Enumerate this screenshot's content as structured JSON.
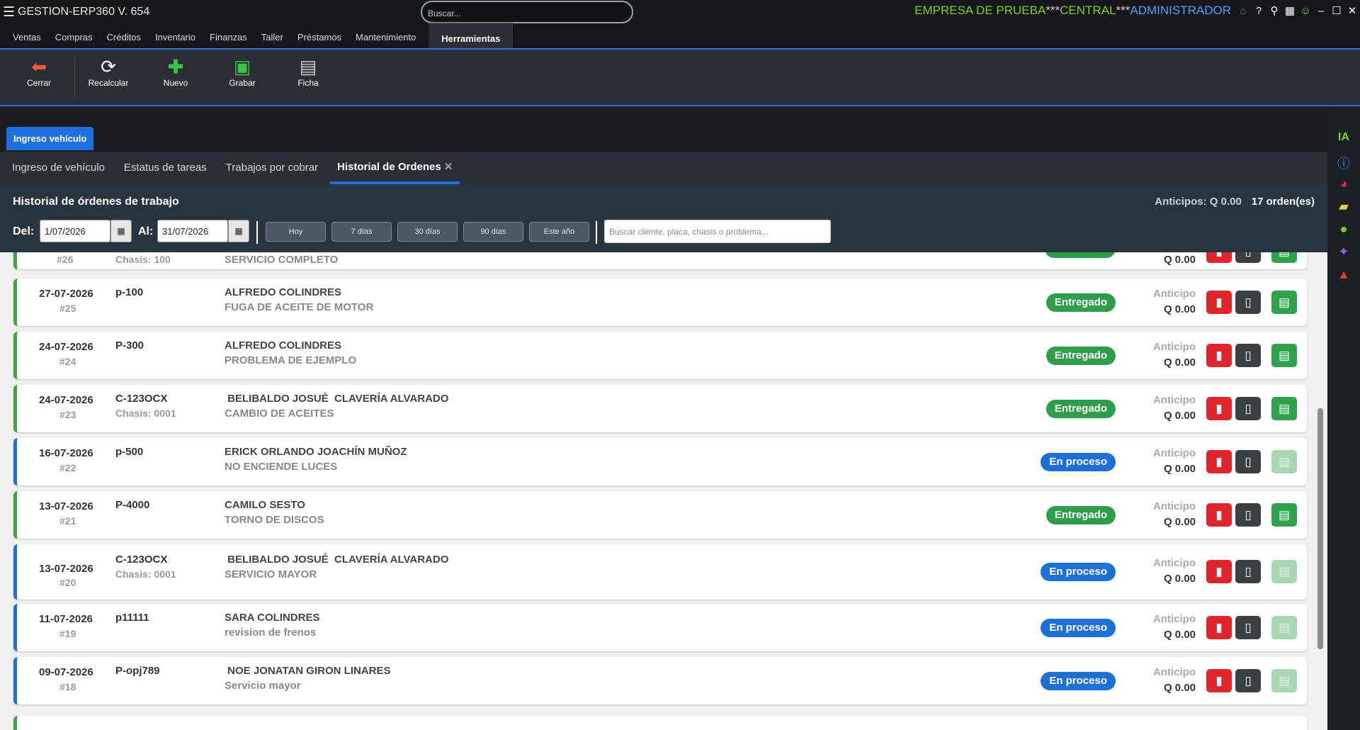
{
  "titlebar": {
    "app_title": "GESTION-ERP360 V. 654",
    "search_placeholder": "Buscar...",
    "company": "EMPRESA DE PRUEBA",
    "branch": "CENTRAL",
    "user": "ADMINISTRADOR",
    "sep": "***"
  },
  "menu": [
    "Ventas",
    "Compras",
    "Créditos",
    "Inventario",
    "Finanzas",
    "Taller",
    "Préstamos",
    "Mantenimiento",
    "Herramientas"
  ],
  "ribbon": {
    "close": "Cerrar",
    "recalc": "Recalcular",
    "new": "Nuevo",
    "save": "Grabar",
    "sheet": "Ficha"
  },
  "doc_tab": "Ingreso vehículo",
  "subtabs": [
    "Ingreso de vehículo",
    "Estatus de tareas",
    "Trabajos por cobrar",
    "Historial de Ordenes"
  ],
  "filter": {
    "title": "Historial de órdenes de trabajo",
    "anticipos_label": "Anticipos: Q 0.00",
    "count_label": "17 orden(es)",
    "del_label": "Del:",
    "al_label": "Al:",
    "from": "1/07/2026",
    "to": "31/07/2026",
    "quick": [
      "Hoy",
      "7 días",
      "30 días",
      "90 días",
      "Este año"
    ],
    "search_placeholder": "Buscar cliente, placa, chasis o problema..."
  },
  "anticipo_label": "Anticipo",
  "partial": {
    "num": "#26",
    "chasis": "Chasis: 100",
    "problem": "SERVICIO COMPLETO",
    "amount": "Q 0.00"
  },
  "orders": [
    {
      "date": "27-07-2026",
      "num": "#25",
      "plate": "p-100",
      "chasis": "",
      "client": "ALFREDO COLINDRES",
      "problem": "FUGA DE ACEITE DE MOTOR",
      "status": "Entregado",
      "amount": "Q 0.00"
    },
    {
      "date": "24-07-2026",
      "num": "#24",
      "plate": "P-300",
      "chasis": "",
      "client": "ALFREDO COLINDRES",
      "problem": "PROBLEMA DE EJEMPLO",
      "status": "Entregado",
      "amount": "Q 0.00"
    },
    {
      "date": "24-07-2026",
      "num": "#23",
      "plate": "C-123OCX",
      "chasis": "Chasis: 0001",
      "client": " BELIBALDO JOSUÉ  CLAVERÍA ALVARADO",
      "problem": "CAMBIO DE ACEITES",
      "status": "Entregado",
      "amount": "Q 0.00"
    },
    {
      "date": "16-07-2026",
      "num": "#22",
      "plate": "p-500",
      "chasis": "",
      "client": "ERICK ORLANDO JOACHÍN MUÑOZ",
      "problem": "NO ENCIENDE LUCES",
      "status": "En proceso",
      "amount": "Q 0.00"
    },
    {
      "date": "13-07-2026",
      "num": "#21",
      "plate": "P-4000",
      "chasis": "",
      "client": "CAMILO SESTO",
      "problem": "TORNO DE DISCOS",
      "status": "Entregado",
      "amount": "Q 0.00"
    },
    {
      "date": "13-07-2026",
      "num": "#20",
      "plate": "C-123OCX",
      "chasis": "Chasis: 0001",
      "client": " BELIBALDO JOSUÉ  CLAVERÍA ALVARADO",
      "problem": "SERVICIO MAYOR",
      "status": "En proceso",
      "amount": "Q 0.00"
    },
    {
      "date": "11-07-2026",
      "num": "#19",
      "plate": "p11111",
      "chasis": "",
      "client": "SARA COLINDRES",
      "problem": "revision de frenos",
      "status": "En proceso",
      "amount": "Q 0.00"
    },
    {
      "date": "09-07-2026",
      "num": "#18",
      "plate": "P-opj789",
      "chasis": "",
      "client": " NOE JONATAN GIRON LINARES",
      "problem": "Servicio mayor",
      "status": "En proceso",
      "amount": "Q 0.00"
    }
  ],
  "side_ia": "IA",
  "colors": {
    "accent": "#1e6fe0",
    "delivered": "#2e9e4a",
    "in_process": "#1e6fd6",
    "company": "#7ed321"
  }
}
